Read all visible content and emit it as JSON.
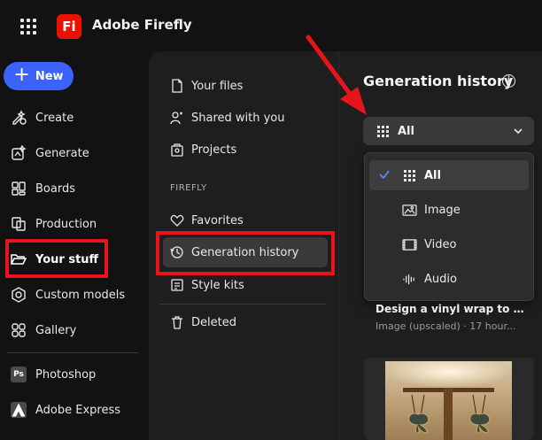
{
  "app": {
    "title": "Adobe Firefly",
    "logo_text": "Fi",
    "brand_color": "#eb1000"
  },
  "sidebar": {
    "new_label": "New",
    "items": [
      {
        "label": "Create",
        "icon": "create-icon"
      },
      {
        "label": "Generate",
        "icon": "generate-icon"
      },
      {
        "label": "Boards",
        "icon": "boards-icon"
      },
      {
        "label": "Production",
        "icon": "production-icon"
      },
      {
        "label": "Your stuff",
        "icon": "folder-icon"
      },
      {
        "label": "Custom models",
        "icon": "custom-models-icon"
      },
      {
        "label": "Gallery",
        "icon": "gallery-icon"
      }
    ],
    "apps": [
      {
        "label": "Photoshop",
        "badge": "Ps"
      },
      {
        "label": "Adobe Express",
        "badge": "Ax"
      }
    ]
  },
  "subnav": {
    "items": [
      {
        "label": "Your files",
        "icon": "document-icon"
      },
      {
        "label": "Shared with you",
        "icon": "shared-icon"
      },
      {
        "label": "Projects",
        "icon": "projects-icon"
      }
    ],
    "section_label": "FIREFLY",
    "firefly_items": [
      {
        "label": "Favorites",
        "icon": "heart-icon"
      },
      {
        "label": "Generation history",
        "icon": "history-icon"
      },
      {
        "label": "Style kits",
        "icon": "style-kits-icon"
      }
    ],
    "deleted_label": "Deleted"
  },
  "main": {
    "title": "Generation history",
    "filter": {
      "selected": "All",
      "options": [
        "All",
        "Image",
        "Video",
        "Audio"
      ]
    },
    "card": {
      "title": "Design a vinyl wrap to go o...",
      "subtitle": "Image (upscaled) · 17 hour..."
    }
  },
  "colors": {
    "accent": "#3b63fb",
    "highlight_box": "#e8141b"
  }
}
